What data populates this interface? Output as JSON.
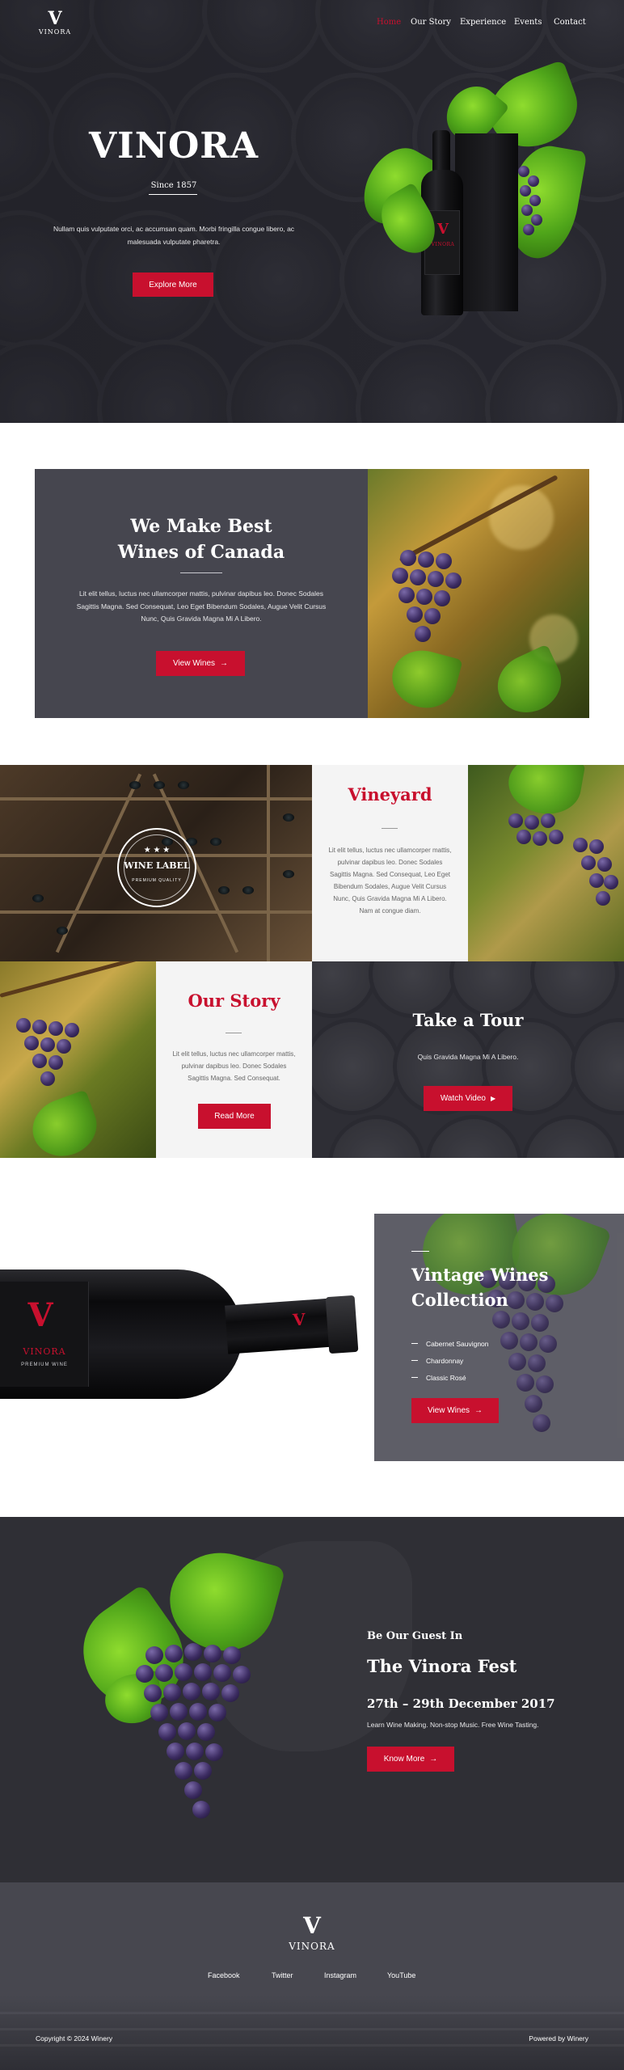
{
  "brand": {
    "logo_mark": "V",
    "logo_word": "VINORA"
  },
  "nav": {
    "items": [
      "Home",
      "Our Story",
      "Experience",
      "Events",
      "Contact"
    ],
    "active_index": 0
  },
  "hero": {
    "title": "VINORA",
    "subtitle": "Since 1857",
    "text": "Nullam quis vulputate orci, ac accumsan quam. Morbi fringilla congue libero, ac malesuada vulputate pharetra.",
    "button": "Explore More",
    "bottle_label_mark": "V",
    "bottle_label_word": "VINORA"
  },
  "intro": {
    "title_line1": "We Make Best",
    "title_line2": "Wines of Canada",
    "text": "Lit elit tellus, luctus nec ullamcorper mattis, pulvinar dapibus leo. Donec Sodales Sagittis Magna. Sed Consequat, Leo Eget Bibendum Sodales, Augue Velit Cursus Nunc, Quis Gravida Magna Mi A Libero.",
    "button": "View Wines"
  },
  "grid": {
    "wine_label_badge": {
      "title": "WINE LABEL",
      "sub": "PREMIUM QUALITY"
    },
    "vineyard": {
      "title": "Vineyard",
      "text": "Lit elit tellus, luctus nec ullamcorper mattis, pulvinar dapibus leo. Donec Sodales Sagittis Magna. Sed Consequat, Leo Eget Bibendum Sodales, Augue Velit Cursus Nunc, Quis Gravida Magna Mi A Libero. Nam at congue diam."
    },
    "our_story": {
      "title": "Our Story",
      "text": "Lit elit tellus, luctus nec ullamcorper mattis, pulvinar dapibus leo. Donec Sodales Sagittis Magna. Sed Consequat.",
      "button": "Read More"
    },
    "tour": {
      "title": "Take a Tour",
      "text": "Quis Gravida Magna Mi A Libero.",
      "button": "Watch Video"
    }
  },
  "collection": {
    "title_line1": "Vintage Wines",
    "title_line2": "Collection",
    "items": [
      "Cabernet Sauvignon",
      "Chardonnay",
      "Classic Rosé"
    ],
    "button": "View Wines",
    "bottle_label_mark": "V",
    "bottle_label_word": "VINORA",
    "bottle_label_sub": "PREMIUM WINE"
  },
  "event": {
    "kicker": "Be Our Guest In",
    "title": "The Vinora Fest",
    "date": "27th – 29th December 2017",
    "text": "Learn Wine Making. Non-stop Music. Free Wine Tasting.",
    "button": "Know More"
  },
  "footer": {
    "links": [
      "Facebook",
      "Twitter",
      "Instagram",
      "YouTube"
    ],
    "copyright": "Copyright © 2024 Winery",
    "powered": "Powered by Winery"
  },
  "colors": {
    "accent": "#c8102e",
    "dark": "#2b2b33",
    "panel": "#46464f",
    "light": "#f4f4f4"
  }
}
